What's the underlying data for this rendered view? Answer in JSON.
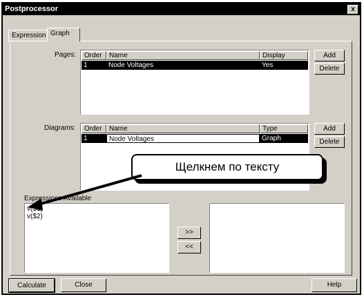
{
  "window": {
    "title": "Postprocessor",
    "close_glyph": "x"
  },
  "tabs": [
    {
      "label": "Expression"
    },
    {
      "label": "Graph"
    }
  ],
  "pages": {
    "label": "Pages:",
    "columns": [
      "Order",
      "Name",
      "Display"
    ],
    "rows": [
      {
        "order": "1",
        "name": "Node Voltages",
        "display": "Yes"
      }
    ],
    "add_label": "Add",
    "delete_label": "Delete"
  },
  "diagrams": {
    "label": "Diagrams:",
    "columns": [
      "Order",
      "Name",
      "Type"
    ],
    "rows": [
      {
        "order": "1",
        "name": "Node Voltages",
        "type": "Graph"
      }
    ],
    "add_label": "Add",
    "delete_label": "Delete"
  },
  "expressions": {
    "label": "Expressions Available",
    "items": [
      "v($1)",
      "v($2)"
    ],
    "move_right_label": ">>",
    "move_left_label": "<<"
  },
  "callout": {
    "text": "Щелкнем по тексту"
  },
  "footer": {
    "calculate_label": "Calculate",
    "close_label": "Close",
    "help_label": "Help"
  }
}
